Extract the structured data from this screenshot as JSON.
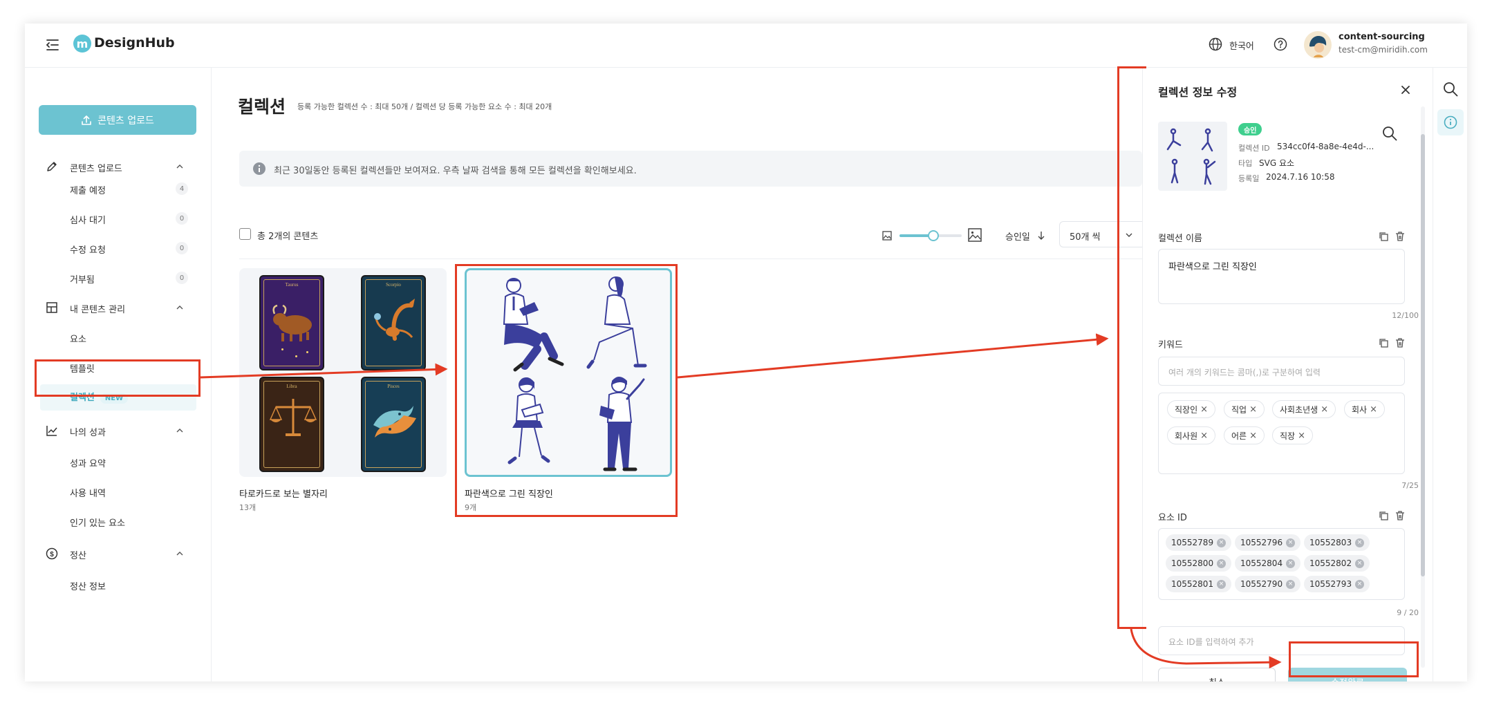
{
  "app": {
    "name": "DesignHub",
    "logo_letter": "m"
  },
  "header": {
    "language": "한국어",
    "user_name": "content-sourcing",
    "user_email": "test-cm@miridih.com"
  },
  "sidebar": {
    "upload_button": "콘텐츠 업로드",
    "sections": [
      {
        "label": "콘텐츠 업로드",
        "icon": "pencil-icon",
        "items": [
          {
            "label": "제출 예정",
            "count": "4"
          },
          {
            "label": "심사 대기",
            "count": "0"
          },
          {
            "label": "수정 요청",
            "count": "0"
          },
          {
            "label": "거부됨",
            "count": "0"
          }
        ]
      },
      {
        "label": "내 콘텐츠 관리",
        "icon": "layout-icon",
        "items": [
          {
            "label": "요소"
          },
          {
            "label": "템플릿"
          },
          {
            "label": "컬렉션",
            "badge": "NEW"
          }
        ]
      },
      {
        "label": "나의 성과",
        "icon": "chart-icon",
        "items": [
          {
            "label": "성과 요약"
          },
          {
            "label": "사용 내역"
          },
          {
            "label": "인기 있는 요소"
          }
        ]
      },
      {
        "label": "정산",
        "icon": "dollar-icon",
        "items": [
          {
            "label": "정산 정보"
          }
        ]
      }
    ]
  },
  "main": {
    "title": "컬렉션",
    "subtitle": "등록 가능한 컬렉션 수 : 최대 50개 / 컬렉션 당 등록 가능한 요소 수 : 최대 20개",
    "notice": "최근 30일동안 등록된 컬렉션들만 보여져요. 우측 날짜 검색을 통해 모든 컬렉션을 확인해보세요.",
    "total_label": "총 2개의 콘텐츠",
    "sort_label": "승인일",
    "per_page": "50개 씩",
    "zoom_level": 0.55,
    "cards": [
      {
        "title": "타로카드로 보는 별자리",
        "count": "13개",
        "tarot_labels": [
          "Taurus",
          "Scorpio",
          "Libra",
          "Pisces"
        ]
      },
      {
        "title": "파란색으로 그린 직장인",
        "count": "9개"
      }
    ]
  },
  "panel": {
    "title": "컬렉션 정보 수정",
    "status_badge": "승인",
    "meta": [
      {
        "label": "컬렉션 ID",
        "value": "534cc0f4-8a8e-4e4d-..."
      },
      {
        "label": "타입",
        "value": "SVG 요소"
      },
      {
        "label": "등록일",
        "value": "2024.7.16 10:58"
      }
    ],
    "name_label": "컬렉션 이름",
    "name_value": "파란색으로 그린 직장인",
    "name_counter": "12/100",
    "keyword_label": "키워드",
    "keyword_placeholder": "여러 개의 키워드는 콤마(,)로 구분하여 입력",
    "keywords": [
      "직장인",
      "직업",
      "사회초년생",
      "회사",
      "회사원",
      "어른",
      "직장"
    ],
    "keyword_counter": "7/25",
    "element_label": "요소 ID",
    "element_ids": [
      "10552789",
      "10552796",
      "10552803",
      "10552800",
      "10552804",
      "10552802",
      "10552801",
      "10552790",
      "10552793"
    ],
    "element_counter": "9 / 20",
    "element_placeholder": "요소 ID를 입력하여 추가",
    "cancel_label": "취소",
    "submit_label": "수정완료"
  },
  "colors": {
    "accent": "#6cc3d1",
    "annotation": "#e33b24",
    "approved": "#3fcf8e",
    "figure_blue": "#3b3f9c"
  }
}
